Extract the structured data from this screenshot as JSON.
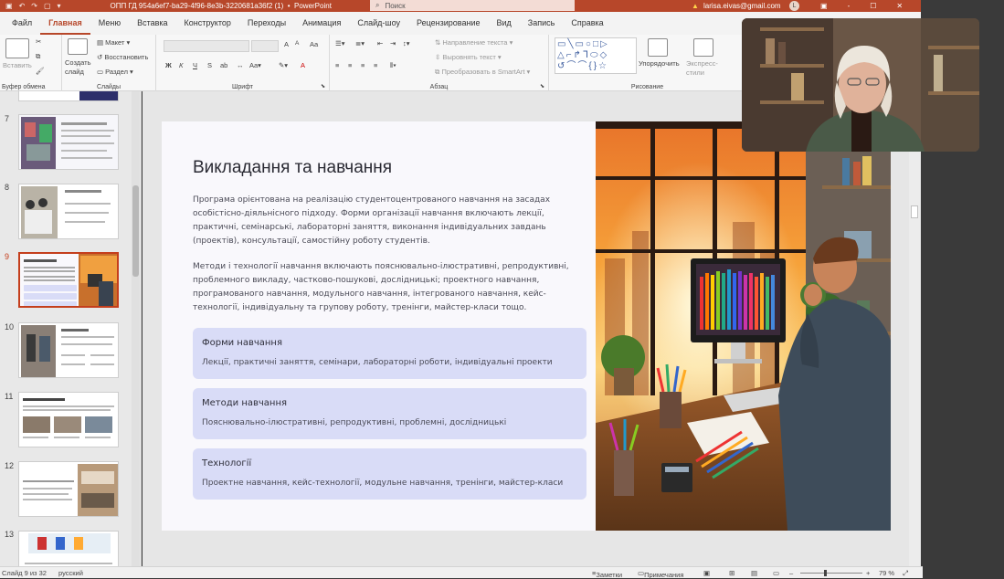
{
  "titlebar": {
    "filename": "ОПП ГД 954a6ef7-ba29-4f96-8e3b-3220681a36f2 (1)",
    "app": "PowerPoint",
    "search_placeholder": "Поиск",
    "account": "larisa.eivas@gmail.com",
    "avatar_initial": "L",
    "bullet": "•",
    "dash": "-"
  },
  "menu": {
    "tabs": [
      "Файл",
      "Главная",
      "Меню",
      "Вставка",
      "Конструктор",
      "Переходы",
      "Анимация",
      "Слайд-шоу",
      "Рецензирование",
      "Вид",
      "Запись",
      "Справка"
    ]
  },
  "ribbon": {
    "clipboard": {
      "paste": "Вставить",
      "label": "Буфер обмена"
    },
    "slides": {
      "new_slide": "Создать слайд",
      "layout": "Макет",
      "reset": "Восстановить",
      "section": "Раздел",
      "label": "Слайды"
    },
    "font": {
      "label": "Шрифт",
      "bold": "Ж",
      "italic": "К",
      "underline": "Ч",
      "strike": "S",
      "size_up": "A",
      "size_down": "A",
      "color": "A",
      "clear": "Aa"
    },
    "paragraph": {
      "text_direction": "Направление текста",
      "align_text": "Выровнять текст",
      "smartart": "Преобразовать в SmartArt",
      "label": "Абзац"
    },
    "drawing": {
      "arrange": "Упорядочить",
      "quick_styles": "Экспресс-стили",
      "label": "Рисование"
    }
  },
  "slides_panel": {
    "thumbnails": [
      {
        "number": "7"
      },
      {
        "number": "8"
      },
      {
        "number": "9"
      },
      {
        "number": "10"
      },
      {
        "number": "11"
      },
      {
        "number": "12"
      },
      {
        "number": "13"
      }
    ]
  },
  "slide": {
    "title": "Викладання та навчання",
    "paragraph1": "Програма орієнтована на реалізацію студентоцентрованого навчання на засадах особістісно-діяльнісного підходу. Форми організації навчання включають лекції, практичні, семінарські, лабораторні заняття, виконання індивідуальних завдань (проектів), консультації, самостійну роботу студентів.",
    "paragraph2": "Методи і технології навчання включають пояснювально-ілюстративні, репродуктивні, проблемного викладу, частково-пошукові, дослідницькі; проектного навчання, програмованого навчання, модульного навчання, інтегрованого навчання, кейс-технології, індивідуальну та групову роботу, тренінги, майстер-класи тощо.",
    "cards": [
      {
        "title": "Форми навчання",
        "body": "Лекції, практичні заняття, семінари, лабораторні роботи, індивідуальні проекти"
      },
      {
        "title": "Методи навчання",
        "body": "Пояснювально-ілюстративні, репродуктивні, проблемні, дослідницькі"
      },
      {
        "title": "Технології",
        "body": "Проектне навчання, кейс-технології, модульне навчання, тренінги, майстер-класи"
      }
    ]
  },
  "statusbar": {
    "slide_counter": "Слайд 9 из 32",
    "language": "русский",
    "notes": "Заметки",
    "comments": "Примечания",
    "zoom": "79 %",
    "zoom_level": 0.79,
    "minus": "–",
    "plus": "+"
  },
  "colors": {
    "accent": "#b7472a",
    "card": "#d9dcf7",
    "selection": "#c43e1c"
  }
}
